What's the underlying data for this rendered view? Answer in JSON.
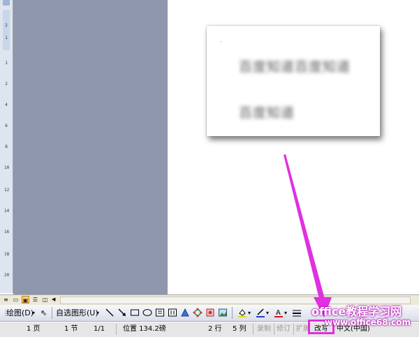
{
  "document": {
    "textbox_line1": "百度知道百度知道",
    "textbox_line2": "百度知道"
  },
  "ruler": {
    "ticks": [
      "2",
      "1",
      "1",
      "2",
      "4",
      "6",
      "8",
      "10",
      "12",
      "14",
      "16",
      "18",
      "20"
    ]
  },
  "draw_toolbar": {
    "draw_menu": "绘图(D)",
    "autoshapes_menu": "自选图形(U)"
  },
  "status_bar": {
    "page": "1 页",
    "section": "1 节",
    "page_of": "1/1",
    "position": "位置 134.2磅",
    "line": "2 行",
    "column": "5 列",
    "rec": "录制",
    "trk": "修订",
    "ext": "扩展",
    "ovr": "改写",
    "language": "中文(中国)"
  },
  "watermark": {
    "title": "office教程学习网",
    "url": "www.office68.com"
  },
  "colors": {
    "highlight": "#e030e0",
    "gray_area": "#8e97ab"
  }
}
